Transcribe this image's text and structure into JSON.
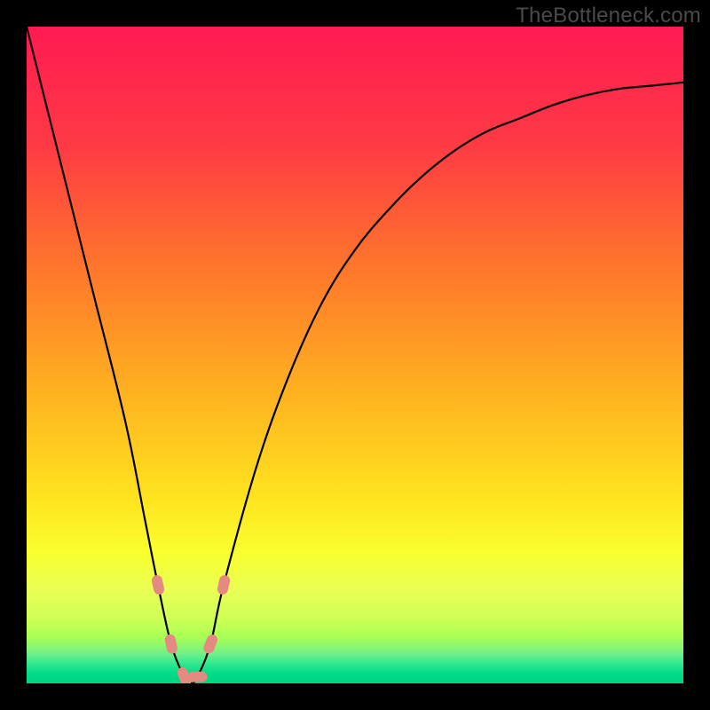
{
  "watermark": "TheBottleneck.com",
  "chart_data": {
    "type": "line",
    "title": "",
    "xlabel": "",
    "ylabel": "",
    "xlim": [
      0,
      100
    ],
    "ylim": [
      0,
      100
    ],
    "x": [
      0,
      5,
      10,
      15,
      18,
      20,
      22,
      24,
      25,
      26,
      28,
      30,
      35,
      40,
      45,
      50,
      55,
      60,
      65,
      70,
      75,
      80,
      85,
      90,
      95,
      100
    ],
    "values": [
      100,
      80,
      60,
      40,
      25,
      15,
      6,
      1,
      0,
      1,
      6,
      15,
      33,
      47,
      58,
      66,
      72,
      77,
      81,
      84,
      86,
      88,
      89.5,
      90.5,
      91,
      91.5
    ],
    "markers": {
      "x": [
        20,
        22,
        24,
        26,
        28,
        30
      ],
      "y": [
        15,
        6,
        1,
        1,
        6,
        15
      ]
    },
    "background_gradient": [
      "#ff1a52",
      "#ff6e2e",
      "#ffd21f",
      "#f7ff2e",
      "#c8ff3a",
      "#00e07a"
    ]
  }
}
